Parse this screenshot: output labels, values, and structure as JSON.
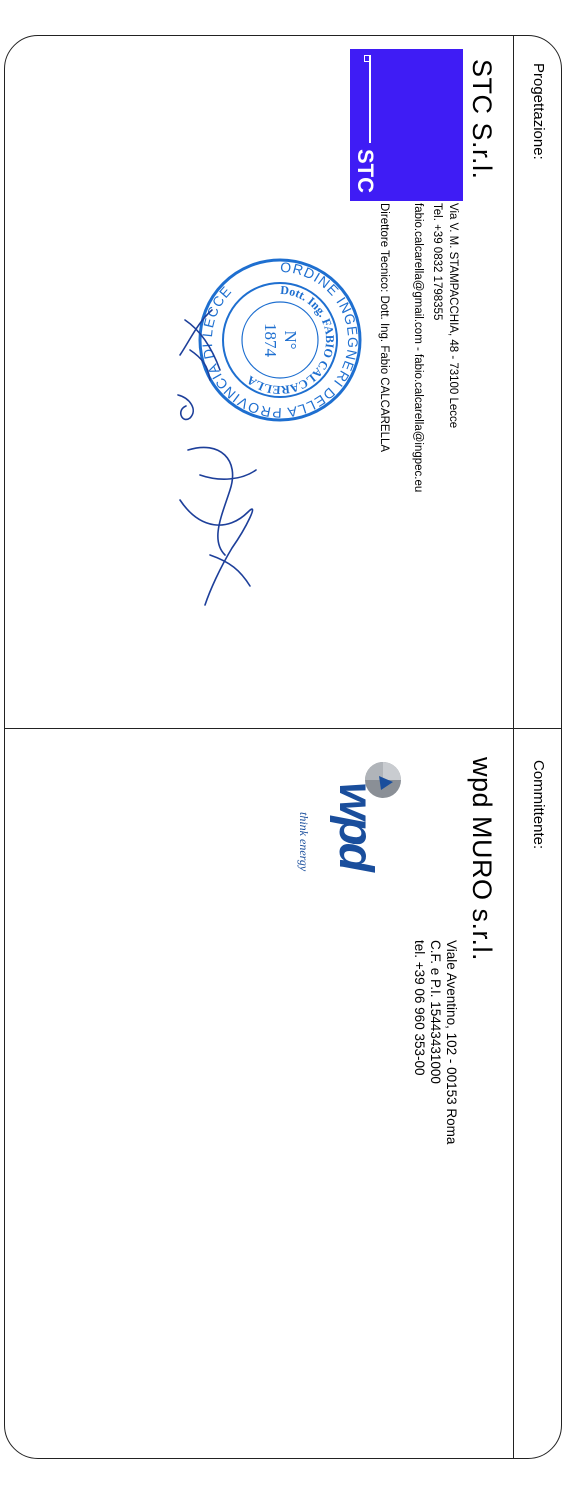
{
  "left_section": {
    "label": "Progettazione:",
    "company": "STC S.r.l.",
    "logo_text": "STC",
    "lines": [
      "Via V. M. STAMPACCHIA, 48 - 73100 Lecce",
      "Tel. +39 0832 1798355",
      "fabio.calcarella@gmail.com - fabio.calcarella@ingpec.eu",
      "Direttore Tecnico: Dott. Ing. Fabio CALCARELLA"
    ],
    "stamp": {
      "outer_text": "ORDINE INGEGNERI DELLA PROVINCIA DI LECCE",
      "inner_text": "Dott. Ing. FABIO CALCARELLA",
      "number_label": "N°",
      "number": "1874"
    }
  },
  "right_section": {
    "label": "Committente:",
    "company": "wpd MURO s.r.l.",
    "lines": [
      "Viale Aventino, 102 - 00153 Roma",
      "C.F. e P.I. 15443431000",
      "tel. +39 06 960 353-00"
    ],
    "logo": {
      "brand": "wpd",
      "tagline": "think energy",
      "brand_color": "#1a4e9c",
      "symbol_color": "#8a8f96"
    }
  },
  "colors": {
    "stc_blue": "#3f1cf5",
    "stamp_blue": "#1e6fd0",
    "signature_blue": "#1d3f9a"
  }
}
